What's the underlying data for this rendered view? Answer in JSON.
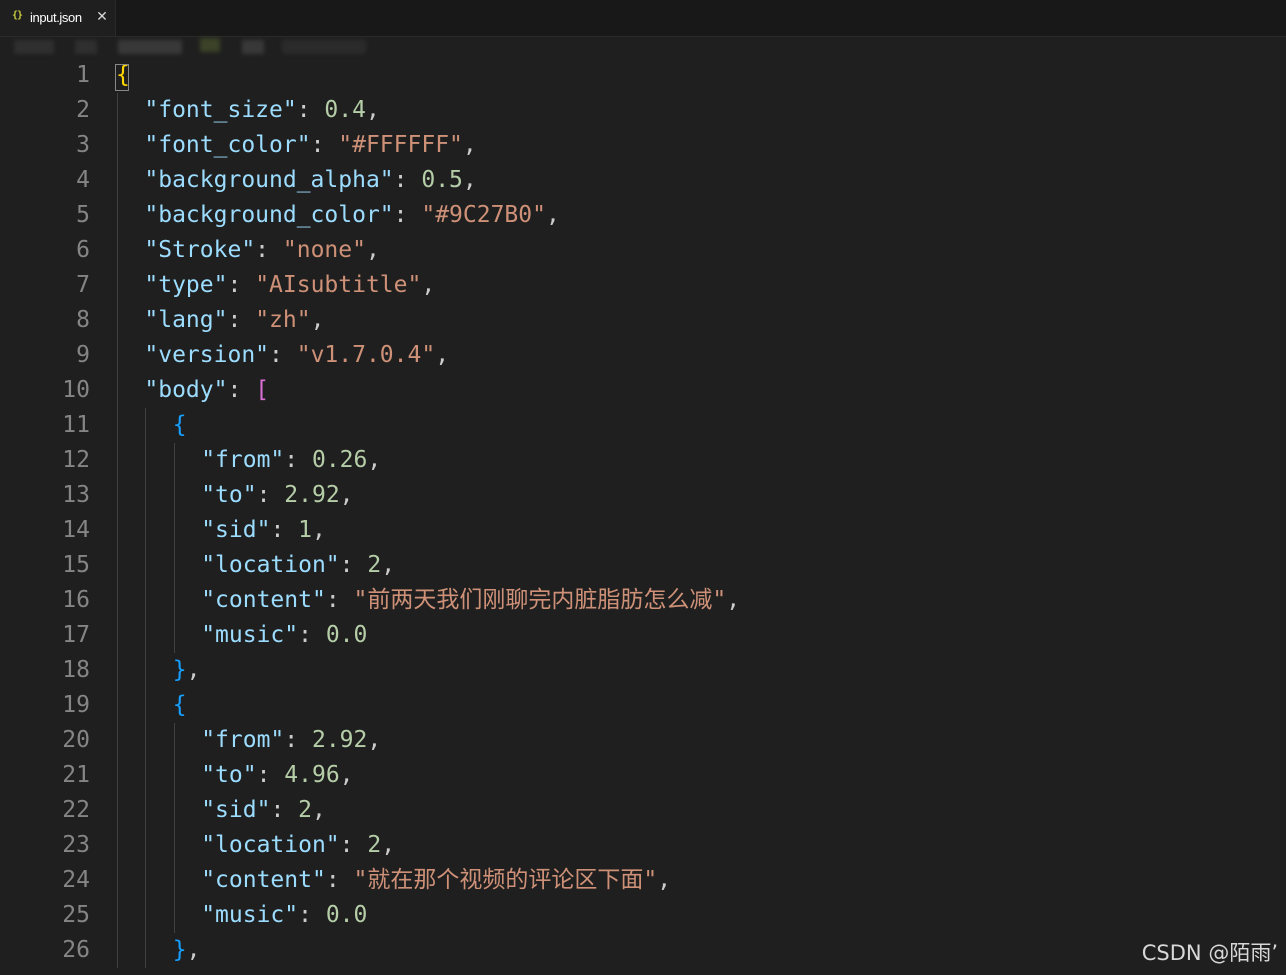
{
  "tab": {
    "icon_glyph": "{}",
    "label": "input.json",
    "close_glyph": "✕"
  },
  "colors": {
    "background": "#1f1f1f",
    "tab_bar": "#181818",
    "line_number": "#858585",
    "key": "#9cdcfe",
    "string": "#ce9178",
    "number": "#b5cea8",
    "punctuation": "#cccccc",
    "brace_level_1": "#ffd700",
    "bracket_level_2": "#da70d6",
    "brace_level_3": "#179fff"
  },
  "code": {
    "lines": [
      {
        "number": "1",
        "indent": 0,
        "tokens": [
          {
            "t": "{",
            "k": "brace-1"
          }
        ]
      },
      {
        "number": "2",
        "indent": 1,
        "tokens": [
          {
            "t": "\"font_size\"",
            "k": "key"
          },
          {
            "t": ": ",
            "k": "punct"
          },
          {
            "t": "0.4",
            "k": "num"
          },
          {
            "t": ",",
            "k": "punct"
          }
        ]
      },
      {
        "number": "3",
        "indent": 1,
        "tokens": [
          {
            "t": "\"font_color\"",
            "k": "key"
          },
          {
            "t": ": ",
            "k": "punct"
          },
          {
            "t": "\"#FFFFFF\"",
            "k": "str"
          },
          {
            "t": ",",
            "k": "punct"
          }
        ]
      },
      {
        "number": "4",
        "indent": 1,
        "tokens": [
          {
            "t": "\"background_alpha\"",
            "k": "key"
          },
          {
            "t": ": ",
            "k": "punct"
          },
          {
            "t": "0.5",
            "k": "num"
          },
          {
            "t": ",",
            "k": "punct"
          }
        ]
      },
      {
        "number": "5",
        "indent": 1,
        "tokens": [
          {
            "t": "\"background_color\"",
            "k": "key"
          },
          {
            "t": ": ",
            "k": "punct"
          },
          {
            "t": "\"#9C27B0\"",
            "k": "str"
          },
          {
            "t": ",",
            "k": "punct"
          }
        ]
      },
      {
        "number": "6",
        "indent": 1,
        "tokens": [
          {
            "t": "\"Stroke\"",
            "k": "key"
          },
          {
            "t": ": ",
            "k": "punct"
          },
          {
            "t": "\"none\"",
            "k": "str"
          },
          {
            "t": ",",
            "k": "punct"
          }
        ]
      },
      {
        "number": "7",
        "indent": 1,
        "tokens": [
          {
            "t": "\"type\"",
            "k": "key"
          },
          {
            "t": ": ",
            "k": "punct"
          },
          {
            "t": "\"AIsubtitle\"",
            "k": "str"
          },
          {
            "t": ",",
            "k": "punct"
          }
        ]
      },
      {
        "number": "8",
        "indent": 1,
        "tokens": [
          {
            "t": "\"lang\"",
            "k": "key"
          },
          {
            "t": ": ",
            "k": "punct"
          },
          {
            "t": "\"zh\"",
            "k": "str"
          },
          {
            "t": ",",
            "k": "punct"
          }
        ]
      },
      {
        "number": "9",
        "indent": 1,
        "tokens": [
          {
            "t": "\"version\"",
            "k": "key"
          },
          {
            "t": ": ",
            "k": "punct"
          },
          {
            "t": "\"v1.7.0.4\"",
            "k": "str"
          },
          {
            "t": ",",
            "k": "punct"
          }
        ]
      },
      {
        "number": "10",
        "indent": 1,
        "tokens": [
          {
            "t": "\"body\"",
            "k": "key"
          },
          {
            "t": ": ",
            "k": "punct"
          },
          {
            "t": "[",
            "k": "bracket-2"
          }
        ]
      },
      {
        "number": "11",
        "indent": 2,
        "tokens": [
          {
            "t": "{",
            "k": "brace-3"
          }
        ]
      },
      {
        "number": "12",
        "indent": 3,
        "tokens": [
          {
            "t": "\"from\"",
            "k": "key"
          },
          {
            "t": ": ",
            "k": "punct"
          },
          {
            "t": "0.26",
            "k": "num"
          },
          {
            "t": ",",
            "k": "punct"
          }
        ]
      },
      {
        "number": "13",
        "indent": 3,
        "tokens": [
          {
            "t": "\"to\"",
            "k": "key"
          },
          {
            "t": ": ",
            "k": "punct"
          },
          {
            "t": "2.92",
            "k": "num"
          },
          {
            "t": ",",
            "k": "punct"
          }
        ]
      },
      {
        "number": "14",
        "indent": 3,
        "tokens": [
          {
            "t": "\"sid\"",
            "k": "key"
          },
          {
            "t": ": ",
            "k": "punct"
          },
          {
            "t": "1",
            "k": "num"
          },
          {
            "t": ",",
            "k": "punct"
          }
        ]
      },
      {
        "number": "15",
        "indent": 3,
        "tokens": [
          {
            "t": "\"location\"",
            "k": "key"
          },
          {
            "t": ": ",
            "k": "punct"
          },
          {
            "t": "2",
            "k": "num"
          },
          {
            "t": ",",
            "k": "punct"
          }
        ]
      },
      {
        "number": "16",
        "indent": 3,
        "tokens": [
          {
            "t": "\"content\"",
            "k": "key"
          },
          {
            "t": ": ",
            "k": "punct"
          },
          {
            "t": "\"前两天我们刚聊完内脏脂肪怎么减\"",
            "k": "str"
          },
          {
            "t": ",",
            "k": "punct"
          }
        ]
      },
      {
        "number": "17",
        "indent": 3,
        "tokens": [
          {
            "t": "\"music\"",
            "k": "key"
          },
          {
            "t": ": ",
            "k": "punct"
          },
          {
            "t": "0.0",
            "k": "num"
          }
        ]
      },
      {
        "number": "18",
        "indent": 2,
        "tokens": [
          {
            "t": "}",
            "k": "brace-3"
          },
          {
            "t": ",",
            "k": "punct"
          }
        ]
      },
      {
        "number": "19",
        "indent": 2,
        "tokens": [
          {
            "t": "{",
            "k": "brace-3"
          }
        ]
      },
      {
        "number": "20",
        "indent": 3,
        "tokens": [
          {
            "t": "\"from\"",
            "k": "key"
          },
          {
            "t": ": ",
            "k": "punct"
          },
          {
            "t": "2.92",
            "k": "num"
          },
          {
            "t": ",",
            "k": "punct"
          }
        ]
      },
      {
        "number": "21",
        "indent": 3,
        "tokens": [
          {
            "t": "\"to\"",
            "k": "key"
          },
          {
            "t": ": ",
            "k": "punct"
          },
          {
            "t": "4.96",
            "k": "num"
          },
          {
            "t": ",",
            "k": "punct"
          }
        ]
      },
      {
        "number": "22",
        "indent": 3,
        "tokens": [
          {
            "t": "\"sid\"",
            "k": "key"
          },
          {
            "t": ": ",
            "k": "punct"
          },
          {
            "t": "2",
            "k": "num"
          },
          {
            "t": ",",
            "k": "punct"
          }
        ]
      },
      {
        "number": "23",
        "indent": 3,
        "tokens": [
          {
            "t": "\"location\"",
            "k": "key"
          },
          {
            "t": ": ",
            "k": "punct"
          },
          {
            "t": "2",
            "k": "num"
          },
          {
            "t": ",",
            "k": "punct"
          }
        ]
      },
      {
        "number": "24",
        "indent": 3,
        "tokens": [
          {
            "t": "\"content\"",
            "k": "key"
          },
          {
            "t": ": ",
            "k": "punct"
          },
          {
            "t": "\"就在那个视频的评论区下面\"",
            "k": "str"
          },
          {
            "t": ",",
            "k": "punct"
          }
        ]
      },
      {
        "number": "25",
        "indent": 3,
        "tokens": [
          {
            "t": "\"music\"",
            "k": "key"
          },
          {
            "t": ": ",
            "k": "punct"
          },
          {
            "t": "0.0",
            "k": "num"
          }
        ]
      },
      {
        "number": "26",
        "indent": 2,
        "tokens": [
          {
            "t": "}",
            "k": "brace-3"
          },
          {
            "t": ",",
            "k": "punct"
          }
        ]
      }
    ]
  },
  "watermark": "CSDN @陌雨’"
}
